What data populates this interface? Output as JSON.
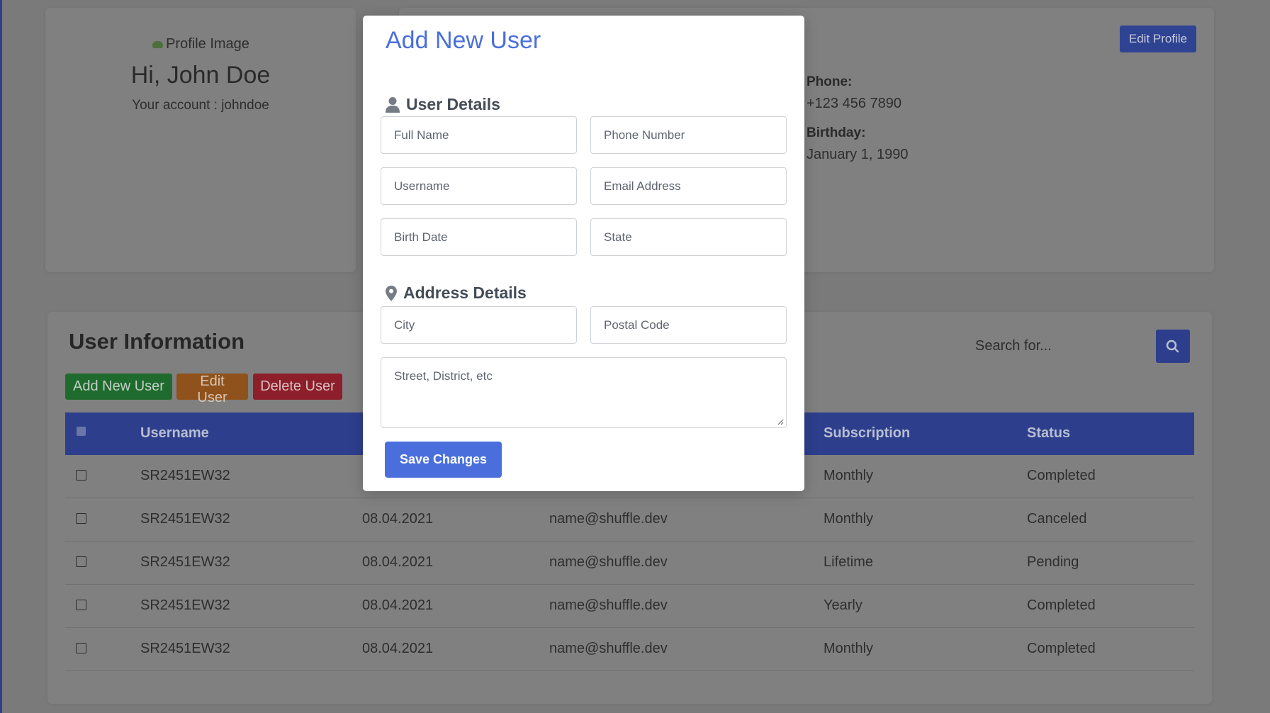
{
  "profile": {
    "image_alt": "Profile Image",
    "greeting": "Hi, John Doe",
    "account": "Your account : johndoe"
  },
  "info": {
    "edit_profile_label": "Edit Profile",
    "phone_label": "Phone:",
    "phone_value": "+123 456 7890",
    "birthday_label": "Birthday:",
    "birthday_value": "January 1, 1990"
  },
  "users": {
    "title": "User Information",
    "add_label": "Add New User",
    "edit_label": "Edit User",
    "delete_label": "Delete User",
    "search_placeholder": "Search for...",
    "columns": {
      "username": "Username",
      "subscription": "Subscription",
      "status": "Status"
    },
    "rows": [
      {
        "username": "SR2451EW32",
        "date": "",
        "email": "",
        "subscription": "Monthly",
        "status": "Completed"
      },
      {
        "username": "SR2451EW32",
        "date": "08.04.2021",
        "email": "name@shuffle.dev",
        "subscription": "Monthly",
        "status": "Canceled"
      },
      {
        "username": "SR2451EW32",
        "date": "08.04.2021",
        "email": "name@shuffle.dev",
        "subscription": "Lifetime",
        "status": "Pending"
      },
      {
        "username": "SR2451EW32",
        "date": "08.04.2021",
        "email": "name@shuffle.dev",
        "subscription": "Yearly",
        "status": "Completed"
      },
      {
        "username": "SR2451EW32",
        "date": "08.04.2021",
        "email": "name@shuffle.dev",
        "subscription": "Monthly",
        "status": "Completed"
      }
    ]
  },
  "modal": {
    "title": "Add New User",
    "user_section": "User Details",
    "address_section": "Address Details",
    "placeholders": {
      "full_name": "Full Name",
      "phone": "Phone Number",
      "username": "Username",
      "email": "Email Address",
      "birth_date": "Birth Date",
      "state": "State",
      "city": "City",
      "postal": "Postal Code",
      "street": "Street, District, etc"
    },
    "save_label": "Save Changes"
  },
  "colors": {
    "accent": "#4a6fdc",
    "table_header": "#2d3f8c",
    "overlay": "#7a7a7a"
  },
  "icons": [
    "user-icon",
    "map-pin-icon",
    "search-icon",
    "broken-image-icon"
  ]
}
